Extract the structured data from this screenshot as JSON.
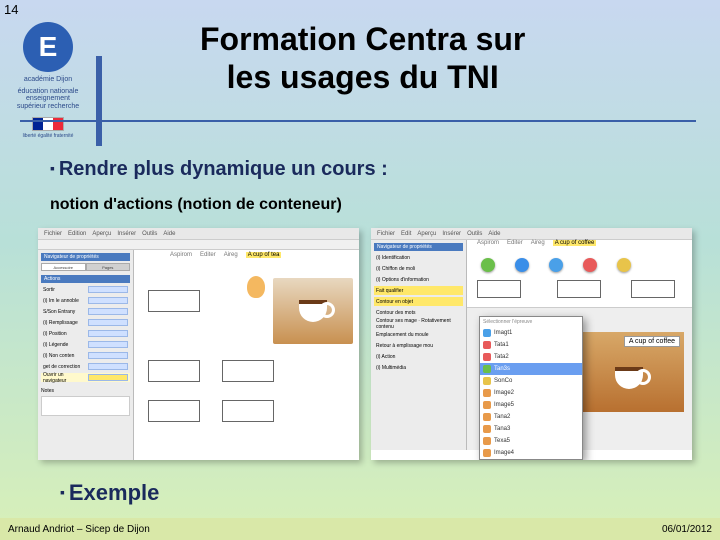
{
  "page_number": "14",
  "logo": {
    "name": "académie Dijon",
    "tagline": "éducation nationale enseignement supérieur recherche",
    "sub": "liberté égalité fraternité"
  },
  "title_line1": "Formation Centra sur",
  "title_line2": "les usages du TNI",
  "section_heading": "Rendre plus dynamique un cours :",
  "section_sub": "notion d'actions (notion de conteneur)",
  "shot_left": {
    "menus": [
      "Fichier",
      "Edition",
      "Aperçu",
      "Insérer",
      "Outils",
      "Aide"
    ],
    "canvas_tabs": [
      "Aspirom",
      "Editer",
      "Aireg",
      "A cup of tea"
    ],
    "canvas_tab_highlight": "A cup of tea",
    "panel_title": "Navigateur de propriétés",
    "panel_tabs": [
      "Accessoire",
      "Pages"
    ],
    "group": "Actions",
    "props": [
      {
        "label": "Sortir",
        "hl": false
      },
      {
        "label": "(i) Im le annoble",
        "hl": false
      },
      {
        "label": "S/Son Entrany",
        "hl": false
      },
      {
        "label": "(i) Remplissage",
        "hl": false
      },
      {
        "label": "(i) Position",
        "hl": false
      },
      {
        "label": "(i) Légende",
        "hl": false
      },
      {
        "label": "(i) Non conten",
        "hl": false
      },
      {
        "label": "get de correction",
        "hl": false
      },
      {
        "label": "Ouvrir un navigateur",
        "hl": true
      }
    ],
    "notes_label": "Notes"
  },
  "shot_right": {
    "menus": [
      "Fichier",
      "Edit",
      "Aperçu",
      "Insérer",
      "Outils",
      "Aide"
    ],
    "ribbon_tabs": [
      "Aspirom",
      "Editer",
      "Aireg",
      "A cup of coffee"
    ],
    "ribbon_highlight": "A cup of coffee",
    "panel_title": "Navigateur de propriétés",
    "dot_colors": [
      "#6bbf4a",
      "#3a8ee8",
      "#4aa0e8",
      "#e85a5a",
      "#e8c44a"
    ],
    "panel_items": [
      {
        "label": "(i) Identification"
      },
      {
        "label": "(i) Chiffon de moli"
      },
      {
        "label": "(i) Options d'information"
      },
      {
        "label": "Fait qualifier",
        "hl": "#ffe86a"
      },
      {
        "label": "Contour en objet",
        "hl": "#ffe86a"
      },
      {
        "label": "Contour des mots"
      },
      {
        "label": "Contour ses mage · Rotativement contenu"
      },
      {
        "label": "Emplacement du moule"
      },
      {
        "label": "Retour à emplissage mou"
      },
      {
        "label": "(i) Action"
      },
      {
        "label": "(i) Multimédia"
      }
    ],
    "dropdown": {
      "header": "Sélectionner l'épreuve",
      "items": [
        {
          "label": "Imagt1",
          "color": "#4aa0e8"
        },
        {
          "label": "Tata1",
          "color": "#e85a5a"
        },
        {
          "label": "Tata2",
          "color": "#e85a5a"
        },
        {
          "label": "Tan3s",
          "color": "#6bbf4a",
          "selected": true
        },
        {
          "label": "SonCo",
          "color": "#e8c44a"
        },
        {
          "label": "Image2",
          "color": "#e89a4a"
        },
        {
          "label": "Image5",
          "color": "#e89a4a"
        },
        {
          "label": "Tana2",
          "color": "#e89a4a"
        },
        {
          "label": "Tana3",
          "color": "#e89a4a"
        },
        {
          "label": "Texa5",
          "color": "#e89a4a"
        },
        {
          "label": "Image4",
          "color": "#e89a4a"
        }
      ]
    },
    "photo_label": "A cup of coffee"
  },
  "example_heading": "Exemple",
  "footer": {
    "author": "Arnaud Andriot – Sicep de Dijon",
    "date": "06/01/2012"
  }
}
